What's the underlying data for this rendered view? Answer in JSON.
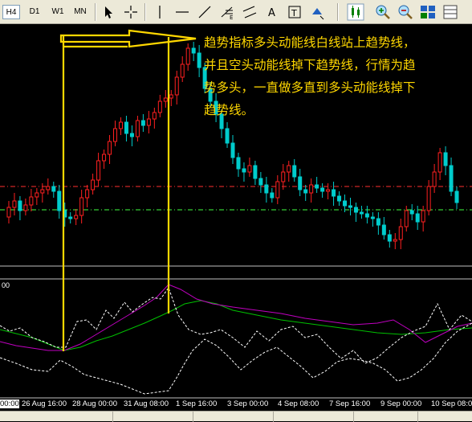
{
  "toolbar": {
    "timeframes": [
      "H4",
      "D1",
      "W1",
      "MN"
    ],
    "active_timeframe": "H4"
  },
  "annotation": {
    "text": "趋势指标多头动能线白线站上趋势线，并且空头动能线掉下趋势线，行情为趋势多头，一直做多直到多头动能线掉下趋势线。"
  },
  "indicator": {
    "scale_top_label": "00"
  },
  "time_axis": {
    "labels": [
      "00:00",
      "26 Aug 16:00",
      "28 Aug 00:00",
      "31 Aug 08:00",
      "1 Sep 16:00",
      "3 Sep 00:00",
      "4 Sep 08:00",
      "7 Sep 16:00",
      "9 Sep 00:00",
      "10 Sep 08:00"
    ]
  },
  "colors": {
    "bull": "#ff2020",
    "bear": "#00cccc",
    "annotation": "#ffd700",
    "white_line": "#ffffff",
    "trend_line": "#00c000",
    "purple_line": "#c000c0"
  }
}
